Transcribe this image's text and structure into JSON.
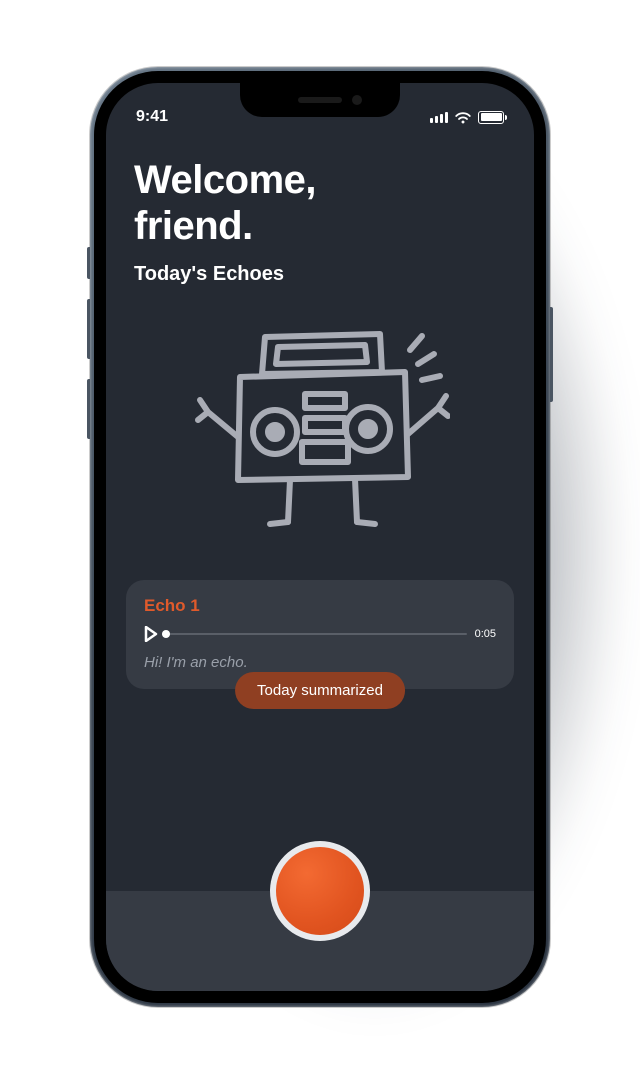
{
  "statusBar": {
    "time": "9:41"
  },
  "header": {
    "title_line1": "Welcome,",
    "title_line2": "friend.",
    "subtitle": "Today's Echoes"
  },
  "echoCard": {
    "title": "Echo 1",
    "duration": "0:05",
    "caption": "Hi! I'm an echo."
  },
  "summaryPill": {
    "label": "Today summarized"
  }
}
